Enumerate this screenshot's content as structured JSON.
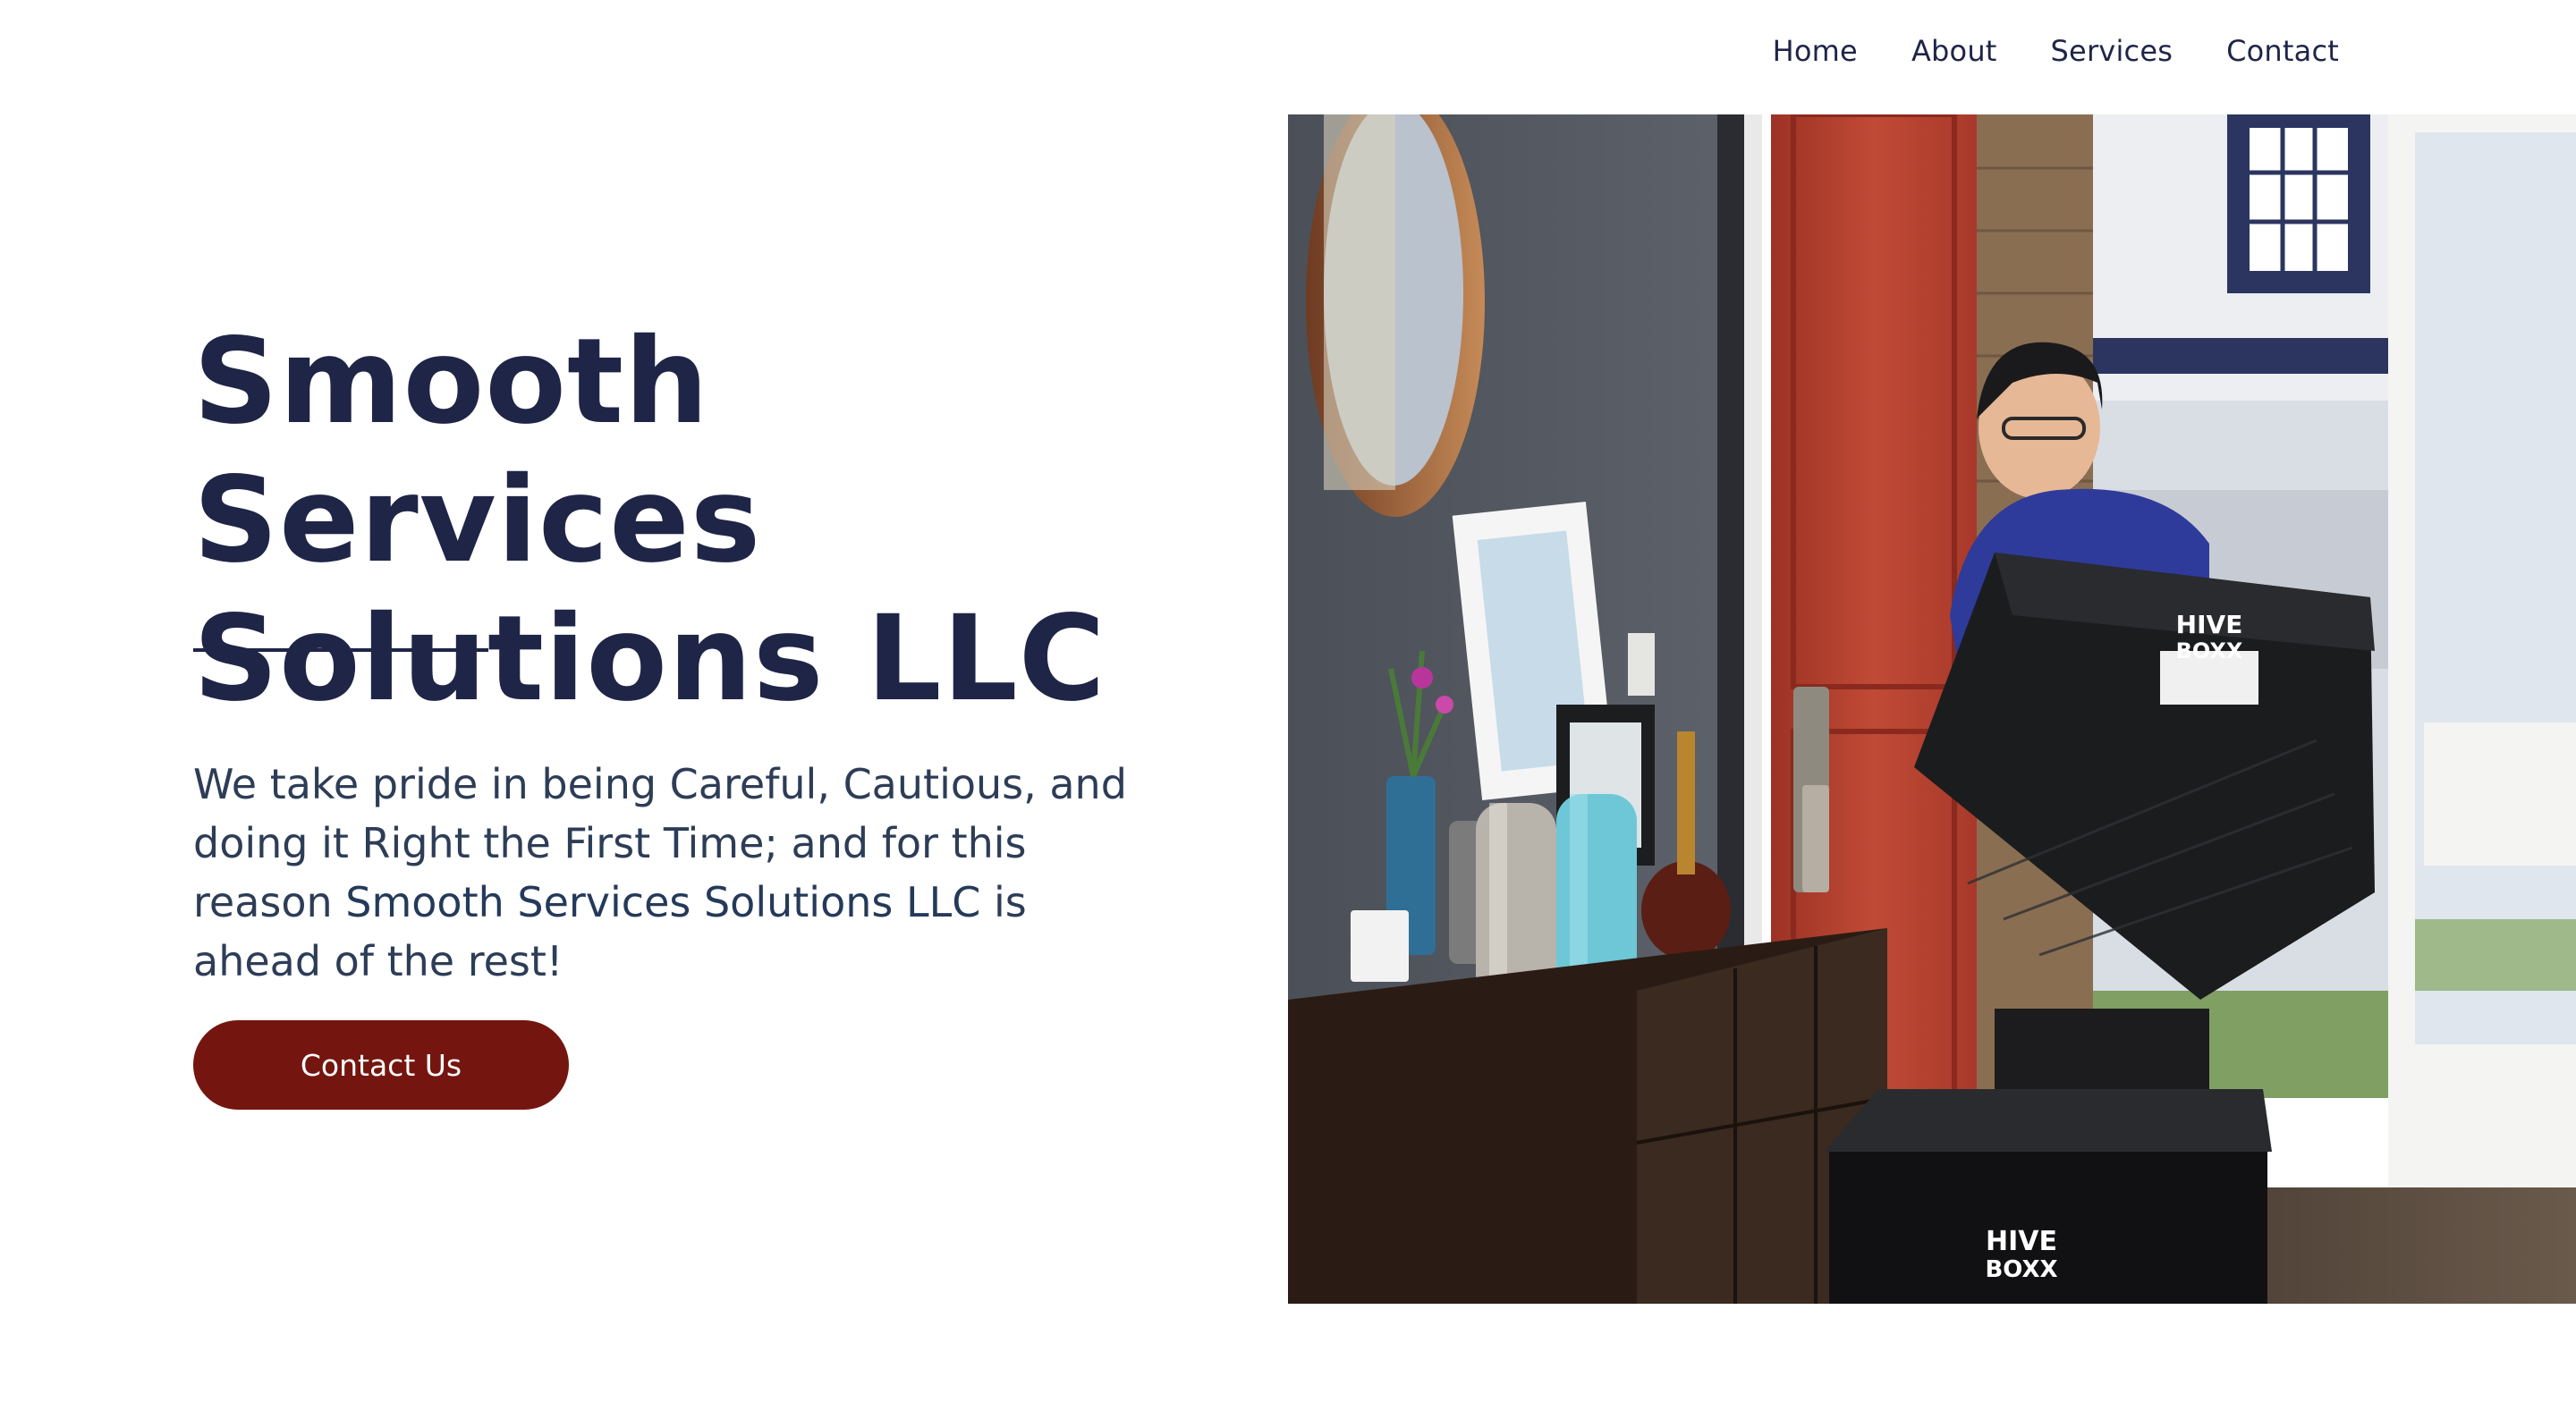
{
  "nav": {
    "items": [
      {
        "label": "Home"
      },
      {
        "label": "About"
      },
      {
        "label": "Services"
      },
      {
        "label": "Contact"
      }
    ]
  },
  "hero": {
    "title": "Smooth Services\nSolutions LLC",
    "description_part1": "We take pride in being Careful, Cautious, and doing it Right the First Time; and for this reason ",
    "description_company": "Smooth Services Solutions LLC",
    "description_part2": " is ahead of the rest!",
    "cta_label": "Contact Us"
  },
  "photo": {
    "box_brand": "HIVE BOXX",
    "box_brand_line1": "HIVE",
    "box_brand_line2": "BOXX"
  },
  "colors": {
    "heading": "#1f2547",
    "body_text": "#2d3d57",
    "cta_background": "#74160f",
    "door_red": "#b2402f"
  }
}
